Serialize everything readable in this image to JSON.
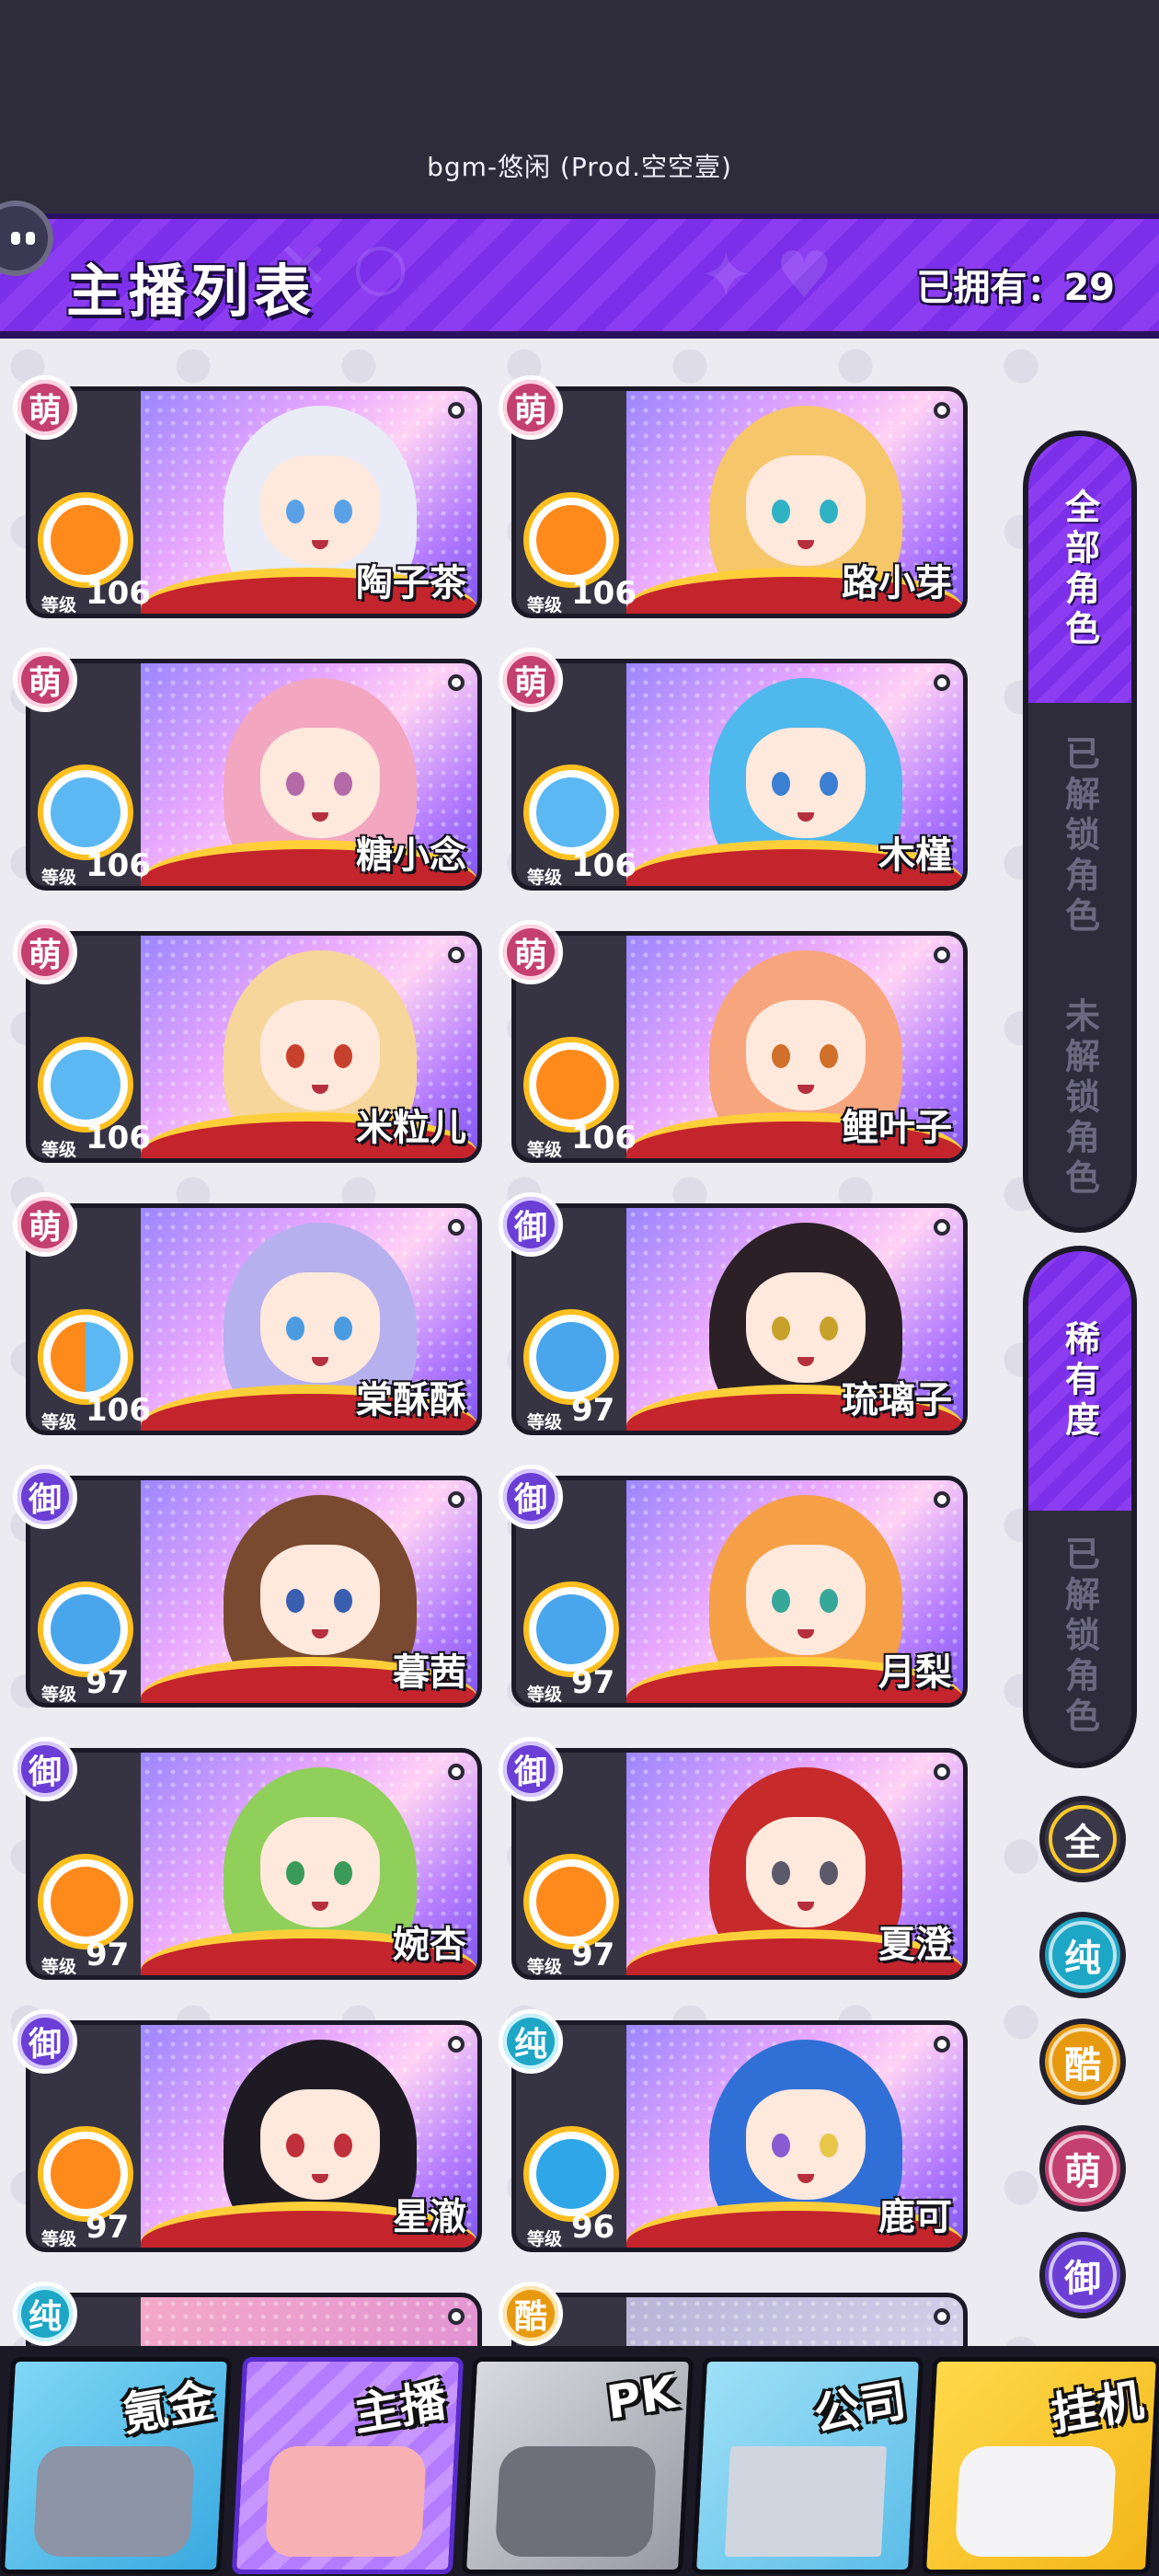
{
  "status_bar": {
    "bgm": "bgm-悠闲 (Prod.空空壹)"
  },
  "header": {
    "title": "主播列表",
    "owned": "已拥有：29"
  },
  "level_label": "等级",
  "badges": {
    "meng": "萌",
    "yu": "御",
    "chun": "纯",
    "ku": "酷"
  },
  "cards": [
    {
      "name": "陶子茶",
      "level": "106",
      "rarity": "萌",
      "icon": "orange-cat-icon"
    },
    {
      "name": "路小芽",
      "level": "106",
      "rarity": "萌",
      "icon": "orange-cat-icon"
    },
    {
      "name": "糖小念",
      "level": "106",
      "rarity": "萌",
      "icon": "blue-cat-icon"
    },
    {
      "name": "木槿",
      "level": "106",
      "rarity": "萌",
      "icon": "blue-cat-icon"
    },
    {
      "name": "米粒儿",
      "level": "106",
      "rarity": "萌",
      "icon": "blue-cat-icon"
    },
    {
      "name": "鲤叶子",
      "level": "106",
      "rarity": "萌",
      "icon": "orange-cat-icon"
    },
    {
      "name": "棠酥酥",
      "level": "106",
      "rarity": "萌",
      "icon": "split-cat-icon"
    },
    {
      "name": "琉璃子",
      "level": "97",
      "rarity": "御",
      "icon": "blue-rose-icon"
    },
    {
      "name": "暮茜",
      "level": "97",
      "rarity": "御",
      "icon": "blue-rose-icon"
    },
    {
      "name": "月梨",
      "level": "97",
      "rarity": "御",
      "icon": "blue-rose-icon"
    },
    {
      "name": "婉杏",
      "level": "97",
      "rarity": "御",
      "icon": "orange-rose-icon"
    },
    {
      "name": "夏澄",
      "level": "97",
      "rarity": "御",
      "icon": "orange-rose-icon"
    },
    {
      "name": "星澈",
      "level": "97",
      "rarity": "御",
      "icon": "orange-rose-icon"
    },
    {
      "name": "鹿可",
      "level": "96",
      "rarity": "纯",
      "icon": "heartbeat-icon"
    }
  ],
  "partial_badges": [
    "纯",
    "酷"
  ],
  "filters": {
    "role_panel": [
      "全部角色",
      "已解锁角色",
      "未解锁角色"
    ],
    "rarity_panel": [
      "稀有度",
      "已解锁角色"
    ],
    "rarity_buttons": [
      "全",
      "纯",
      "酷",
      "萌",
      "御"
    ]
  },
  "bottom_nav": [
    "氪金",
    "主播",
    "PK",
    "公司",
    "挂机"
  ],
  "colors": {
    "accent": "#7b2fe8",
    "meng": "#c4406e",
    "yu": "#6b3ed6",
    "chun": "#1ea6c6",
    "ku": "#e79a10"
  }
}
